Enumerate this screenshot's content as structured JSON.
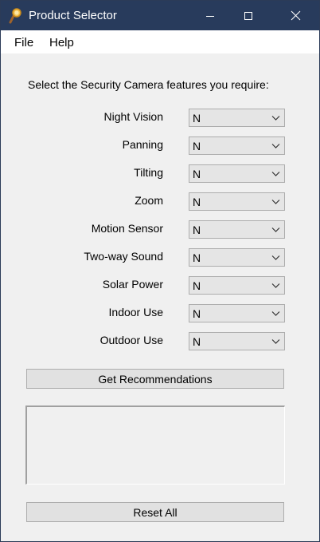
{
  "window": {
    "title": "Product Selector",
    "icon": "magnifier-icon"
  },
  "menu": {
    "items": [
      "File",
      "Help"
    ]
  },
  "prompt": "Select the Security Camera features you require:",
  "features": [
    {
      "label": "Night Vision",
      "value": "N"
    },
    {
      "label": "Panning",
      "value": "N"
    },
    {
      "label": "Tilting",
      "value": "N"
    },
    {
      "label": "Zoom",
      "value": "N"
    },
    {
      "label": "Motion Sensor",
      "value": "N"
    },
    {
      "label": "Two-way Sound",
      "value": "N"
    },
    {
      "label": "Solar Power",
      "value": "N"
    },
    {
      "label": "Indoor Use",
      "value": "N"
    },
    {
      "label": "Outdoor Use",
      "value": "N"
    }
  ],
  "buttons": {
    "recommend": "Get Recommendations",
    "reset": "Reset All"
  },
  "output": {
    "text": ""
  },
  "colors": {
    "titlebar": "#283b5c",
    "window_bg": "#f0f0f0",
    "button_bg": "#e1e1e1",
    "combo_bg": "#e5e5e5"
  }
}
